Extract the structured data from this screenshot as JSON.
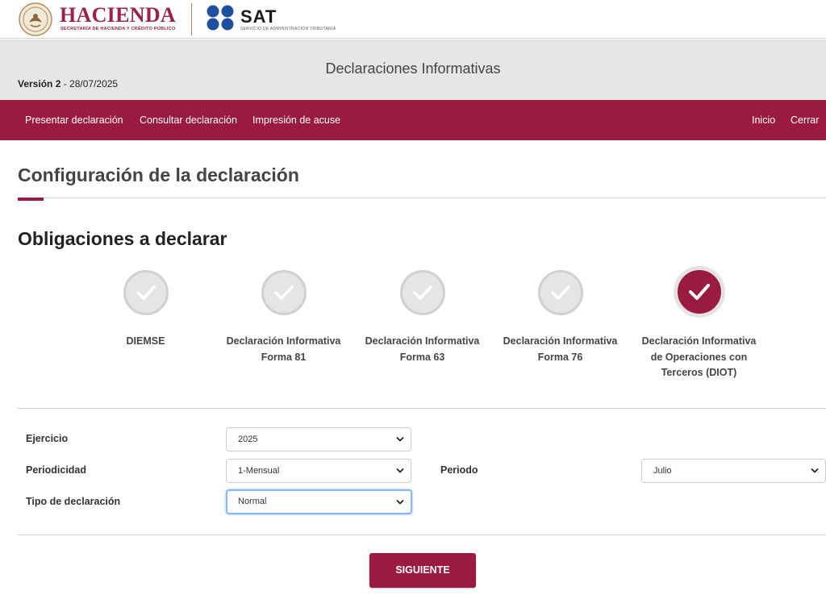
{
  "header": {
    "hacienda_name": "HACIENDA",
    "hacienda_subtitle": "SECRETARÍA DE HACIENDA Y CRÉDITO PÚBLICO",
    "sat_name": "SAT",
    "sat_subtitle": "SERVICIO DE ADMINISTRACIÓN TRIBUTARIA",
    "brand_color": "#9b2247"
  },
  "app": {
    "title": "Declaraciones Informativas",
    "version_label": "Versión 2",
    "version_date": "- 28/07/2025"
  },
  "nav": {
    "left": [
      "Presentar declaración",
      "Consultar declaración",
      "Impresión de acuse"
    ],
    "right": [
      "Inicio",
      "Cerrar"
    ],
    "color": "#9b1b40"
  },
  "page": {
    "title": "Configuración de la declaración",
    "obligations_title": "Obligaciones a declarar"
  },
  "obligations": [
    {
      "line1": "DIEMSE",
      "line2": "",
      "line3": "",
      "selected": false
    },
    {
      "line1": "Declaración Informativa",
      "line2": "Forma 81",
      "line3": "",
      "selected": false
    },
    {
      "line1": "Declaración Informativa",
      "line2": "Forma 63",
      "line3": "",
      "selected": false
    },
    {
      "line1": "Declaración Informativa",
      "line2": "Forma 76",
      "line3": "",
      "selected": false
    },
    {
      "line1": "Declaración Informativa",
      "line2": "de Operaciones con",
      "line3": "Terceros (DIOT)",
      "selected": true
    }
  ],
  "form": {
    "ejercicio": {
      "label": "Ejercicio",
      "value": "2025"
    },
    "periodicidad": {
      "label": "Periodicidad",
      "value": "1-Mensual"
    },
    "periodo": {
      "label": "Periodo",
      "value": "Julio"
    },
    "tipo": {
      "label": "Tipo de declaración",
      "value": "Normal"
    }
  },
  "actions": {
    "next_label": "SIGUIENTE"
  }
}
